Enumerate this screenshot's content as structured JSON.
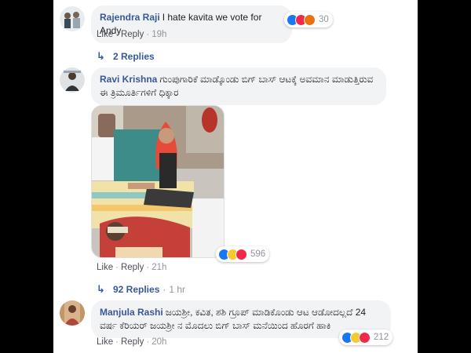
{
  "comments": [
    {
      "author": "Rajendra Raji",
      "text": "I hate kavita we vote for Andy",
      "actions": {
        "like": "Like",
        "reply": "Reply",
        "time": "19h"
      },
      "reactions": {
        "icons": [
          "like-icon",
          "love-icon",
          "angry-icon"
        ],
        "count": "30"
      },
      "replies": {
        "label": "2 Replies",
        "time": ""
      }
    },
    {
      "author": "Ravi Krishna",
      "text": "ಗುಂಪುಗಾರಿಕೆ ಮಾಡ್ಕೊಂಡು ಬಿಗ್ ಬಾಸ್ ಆಟಕ್ಕೆ ಅವಮಾನ ಮಾಡುತ್ತಿರುವ ಈ ತ್ರಿಮೂರ್ತಿಗಳಿಗೆ ಧಿಕ್ಕಾರ",
      "photo_label": "",
      "actions": {
        "like": "Like",
        "reply": "Reply",
        "time": "21h"
      },
      "reactions": {
        "icons": [
          "like-icon",
          "haha-icon",
          "love-icon"
        ],
        "count": "596"
      },
      "replies": {
        "label": "92 Replies",
        "time": "1 hr"
      }
    },
    {
      "author": "Manjula Rashi",
      "text": "ಜಯಶ್ರೀ, ಕವಿತ, ಶಶಿ ಗ್ರೂಪ್ ಮಾಡಿಕೊಂಡು ಆಟ ಆಡೋದಲ್ಲದೆ 24 ವರ್ಷ ಕೆರಿಯರ್ ಜಯಶ್ರೀ ನ ಮೊದಲು ಬಿಗ್ ಬಾಸ್ ಮನೆಯಿಂದ ಹೊರಗೆ ಹಾಕಿ",
      "actions": {
        "like": "Like",
        "reply": "Reply",
        "time": "20h"
      },
      "reactions": {
        "icons": [
          "like-icon",
          "haha-icon",
          "love-icon"
        ],
        "count": "212"
      }
    }
  ],
  "colors": {
    "author": "#385898",
    "bubble": "#f2f3f5",
    "meta": "#90949c",
    "like": "#1877f2",
    "love": "#f0284a",
    "haha": "#f7c930",
    "angry": "#e9710f"
  }
}
